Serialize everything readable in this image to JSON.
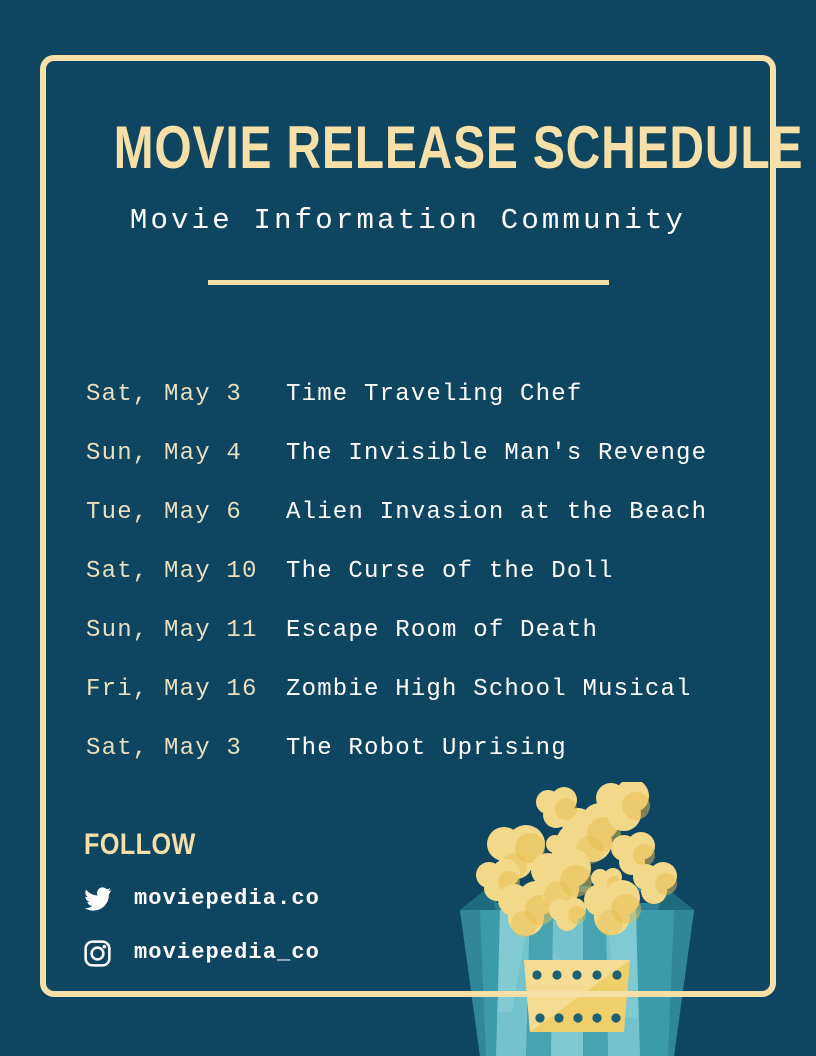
{
  "poster": {
    "title": "MOVIE RELEASE SCHEDULE",
    "subtitle": "Movie Information Community"
  },
  "colors": {
    "background": "#0E4662",
    "border": "#F7DFA8",
    "title_text": "#F7DFA8",
    "subtitle_text": "#FFFFFF",
    "date_text": "#EADFBE",
    "movie_text": "#FFFFFF",
    "divider": "#F2DEA7",
    "popcorn_light": "#F2D98A",
    "popcorn_dark": "#E8BC4E",
    "bucket_light": "#72C3CC",
    "bucket_dark": "#3C9BAA",
    "label": "#F0CE6A"
  },
  "schedule": [
    {
      "date": "Sat, May 3",
      "movie": "Time Traveling Chef"
    },
    {
      "date": "Sun, May 4",
      "movie": "The Invisible Man's Revenge"
    },
    {
      "date": "Tue, May 6",
      "movie": "Alien Invasion at the Beach"
    },
    {
      "date": "Sat, May 10",
      "movie": "The Curse of the Doll"
    },
    {
      "date": "Sun, May 11",
      "movie": "Escape Room of Death"
    },
    {
      "date": "Fri, May 16",
      "movie": "Zombie High School Musical"
    },
    {
      "date": "Sat, May 3",
      "movie": "The Robot Uprising"
    }
  ],
  "follow": {
    "heading": "FOLLOW",
    "accounts": [
      {
        "icon": "twitter-icon",
        "handle": "moviepedia.co"
      },
      {
        "icon": "instagram-icon",
        "handle": "moviepedia_co"
      }
    ]
  },
  "illustration": {
    "name": "popcorn-bucket-illustration"
  }
}
